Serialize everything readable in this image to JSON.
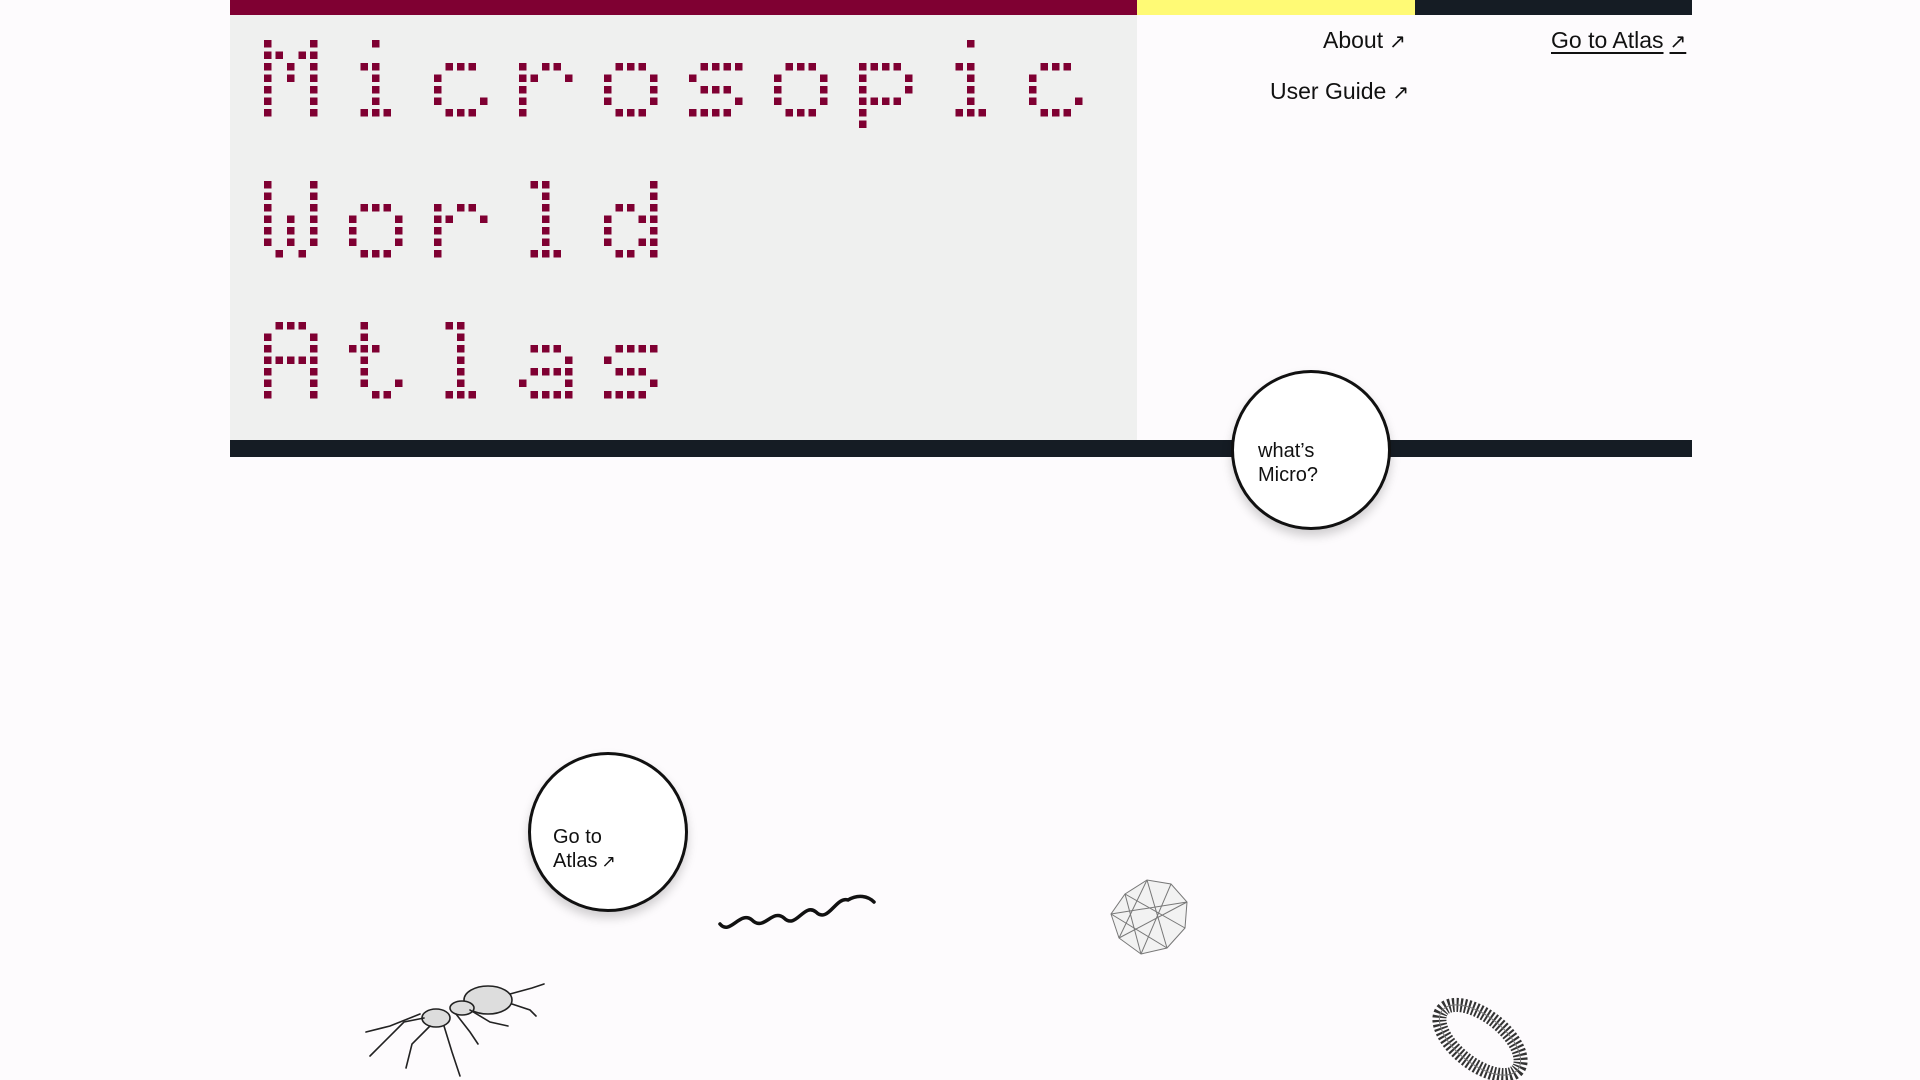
{
  "hero": {
    "title_lines": [
      "Microsopic",
      "World",
      "Atlas"
    ]
  },
  "nav": {
    "about_label": "About",
    "about_icon": "arrow-up-right-icon",
    "guide_label": "User Guide",
    "guide_icon": "arrow-up-right-icon",
    "atlas_label": "Go to Atlas",
    "atlas_icon": "arrow-up-right-icon"
  },
  "buttons": {
    "whats_micro": {
      "line1": "what’s",
      "line2": "Micro?"
    },
    "go_to_atlas": {
      "line1": "Go to",
      "line2": "Atlas"
    }
  },
  "specimens": [
    "ant-wireframe",
    "wavy-line",
    "crystal-wireframe",
    "ring-wireframe"
  ],
  "colors": {
    "accent_red": "#7f0032",
    "accent_yellow": "#fffa75",
    "dark": "#151c24",
    "panel_bg": "#eff0ef",
    "page_bg": "#fdfbfd"
  }
}
